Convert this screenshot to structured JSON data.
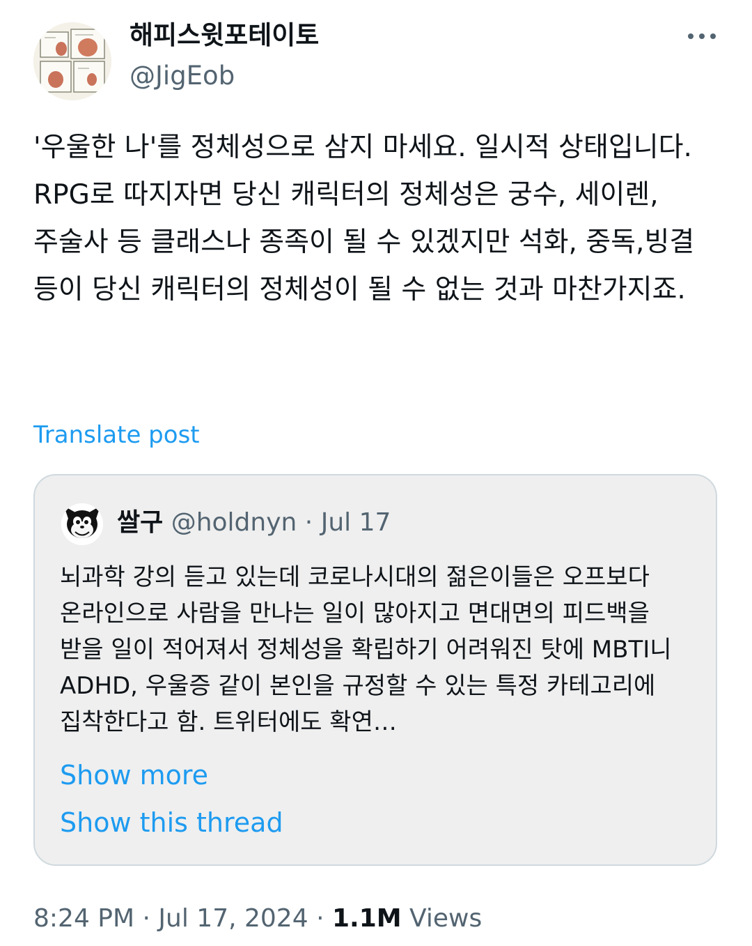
{
  "author": {
    "display_name": "해피스윗포테이토",
    "handle": "@JigEob",
    "avatar_icon": "sweet-potato-comic-avatar"
  },
  "header": {
    "more_icon": "more-horizontal-icon"
  },
  "post": {
    "text": "'우울한 나'를 정체성으로 삼지 마세요. 일시적 상태입니다.\nRPG로 따지자면 당신 캐릭터의 정체성은 궁수, 세이렌, 주술사 등 클래스나 종족이 될 수 있겠지만 석화, 중독,빙결 등이 당신 캐릭터의 정체성이 될 수 없는 것과 마찬가지죠.",
    "translate_label": "Translate post"
  },
  "quote": {
    "avatar_icon": "felix-the-cat-avatar",
    "display_name": "쌀구",
    "handle": "@holdnyn",
    "separator": "·",
    "date": "Jul 17",
    "text": "뇌과학 강의 듣고 있는데 코로나시대의 젊은이들은 오프보다 온라인으로 사람을 만나는 일이 많아지고 면대면의 피드백을 받을 일이 적어져서 정체성을 확립하기 어려워진 탓에 MBTI니 ADHD, 우울증 같이 본인을 규정할 수 있는 특정 카테고리에 집착한다고 함. 트위터에도 확연…",
    "show_more_label": "Show more",
    "show_thread_label": "Show this thread"
  },
  "footer": {
    "time": "8:24 PM",
    "separator": "·",
    "date": "Jul 17, 2024",
    "views_count": "1.1M",
    "views_label": "Views"
  },
  "colors": {
    "link": "#1d9bf0",
    "secondary_text": "#536471",
    "primary_text": "#0f1419",
    "quote_background": "#efefef",
    "quote_border": "#cfd9de"
  }
}
